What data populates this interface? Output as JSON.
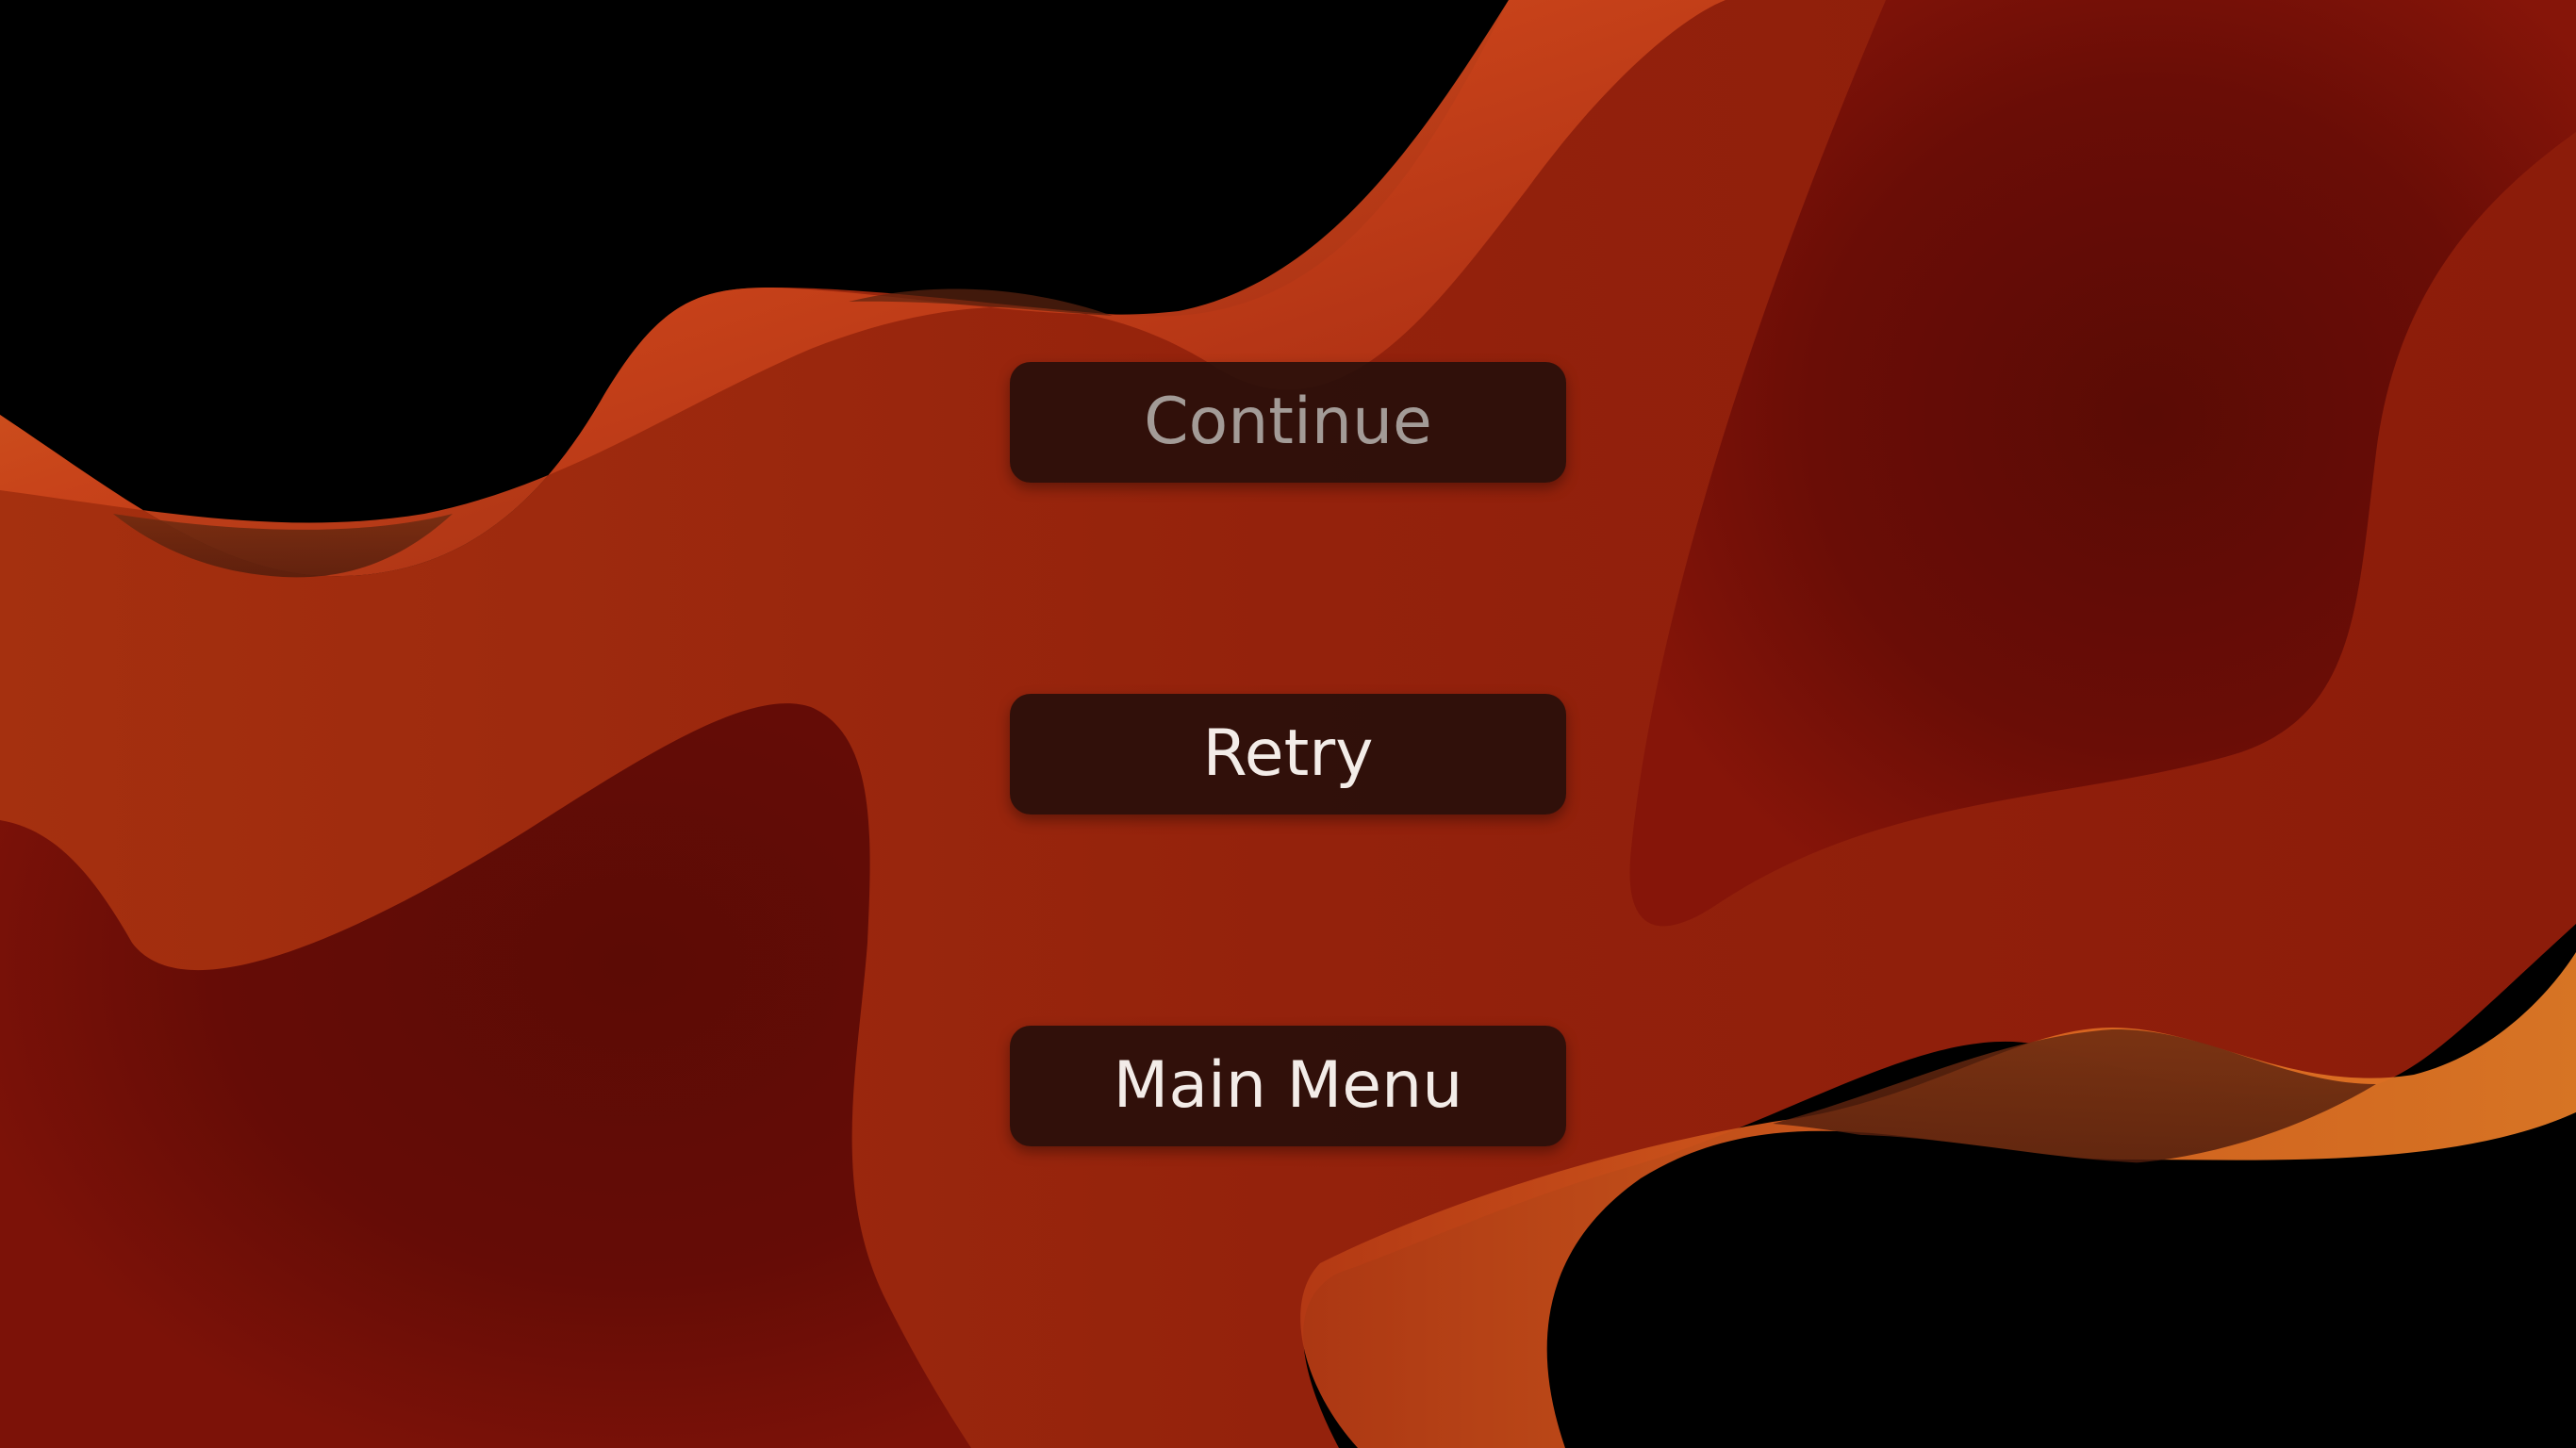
{
  "menu": {
    "continue_label": "Continue",
    "retry_label": "Retry",
    "main_menu_label": "Main Menu"
  },
  "colors": {
    "background": "#000000",
    "orange_light": "#d86a22",
    "orange_mid": "#c0401a",
    "red_mid": "#94220c",
    "red_dark": "#5f0b05",
    "button_fill": "#260e0a",
    "button_text": "#f3ece8",
    "button_text_disabled": "#a39b97"
  }
}
